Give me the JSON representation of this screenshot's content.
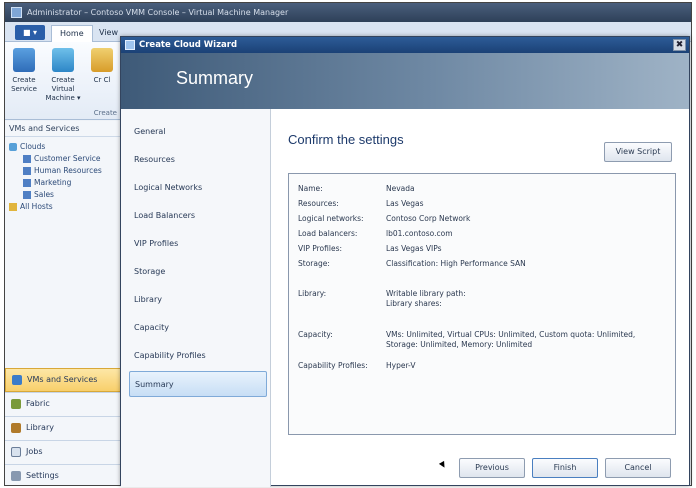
{
  "os_window": {
    "title": "Administrator – Contoso VMM Console – Virtual Machine Manager"
  },
  "ribbon": {
    "file_label": "■ ▾",
    "tabs": [
      "Home",
      "View"
    ],
    "buttons": [
      {
        "label": "Create Service",
        "icon": "service-icon"
      },
      {
        "label": "Create Virtual Machine ▾",
        "icon": "vm-icon"
      },
      {
        "label": "Cr Cl",
        "icon": "cloud-icon"
      }
    ],
    "group_label": "Create"
  },
  "navigation": {
    "header": "VMs and Services",
    "tree": [
      {
        "label": "Clouds",
        "level": 0
      },
      {
        "label": "Customer Service",
        "level": 1
      },
      {
        "label": "Human Resources",
        "level": 1
      },
      {
        "label": "Marketing",
        "level": 1
      },
      {
        "label": "Sales",
        "level": 1
      },
      {
        "label": "All Hosts",
        "level": 0
      }
    ],
    "workspaces": [
      "VMs and Services",
      "Fabric",
      "Library",
      "Jobs",
      "Settings"
    ]
  },
  "wizard": {
    "title": "Create Cloud Wizard",
    "banner_title": "Summary",
    "steps": [
      "General",
      "Resources",
      "Logical Networks",
      "Load Balancers",
      "VIP Profiles",
      "Storage",
      "Library",
      "Capacity",
      "Capability Profiles",
      "Summary"
    ],
    "active_step": "Summary",
    "confirm_title": "Confirm the settings",
    "view_script_label": "View Script",
    "settings": [
      {
        "key": "Name:",
        "value": "Nevada"
      },
      {
        "key": "Resources:",
        "value": "Las Vegas"
      },
      {
        "key": "Logical networks:",
        "value": "Contoso Corp Network"
      },
      {
        "key": "Load balancers:",
        "value": "lb01.contoso.com"
      },
      {
        "key": "VIP Profiles:",
        "value": "Las Vegas VIPs"
      },
      {
        "key": "Storage:",
        "value": "Classification: High Performance SAN"
      },
      {
        "key": "Library:",
        "value": "Writable library path:\nLibrary shares:"
      },
      {
        "key": "Capacity:",
        "value": "VMs: Unlimited, Virtual CPUs: Unlimited, Custom quota: Unlimited, Storage: Unlimited, Memory: Unlimited"
      },
      {
        "key": "Capability Profiles:",
        "value": "Hyper-V"
      }
    ],
    "buttons": {
      "previous": "Previous",
      "finish": "Finish",
      "cancel": "Cancel"
    },
    "close_glyph": "✖"
  }
}
